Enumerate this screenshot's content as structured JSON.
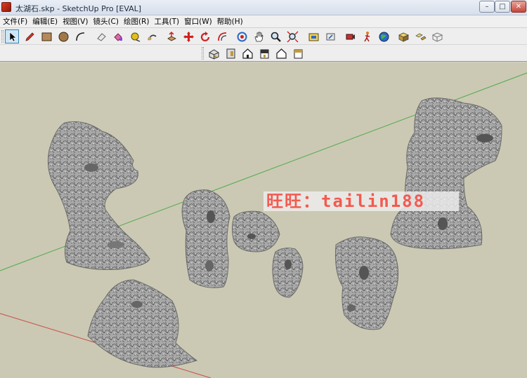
{
  "window": {
    "title": "太湖石.skp - SketchUp Pro [EVAL]",
    "minimize": "–",
    "maximize": "□",
    "close": "✕"
  },
  "menu": {
    "items": [
      "文件(F)",
      "编辑(E)",
      "视图(V)",
      "镜头(C)",
      "绘图(R)",
      "工具(T)",
      "窗口(W)",
      "帮助(H)"
    ]
  },
  "toolbar_main": {
    "tools": [
      "select-tool",
      "pencil-tool",
      "rectangle-tool",
      "circle-tool",
      "arc-tool",
      "eraser-tool",
      "paint-tool",
      "tape-tool",
      "follow-me-tool",
      "push-pull-tool",
      "move-tool",
      "rotate-tool",
      "offset-tool",
      "orbit-tool",
      "pan-tool",
      "zoom-tool",
      "zoom-extents-tool",
      "warehouse-tool",
      "share-model-tool",
      "position-camera-tool",
      "walk-tool",
      "geolocation-tool",
      "component-tool",
      "explode-tool",
      "xray-tool"
    ],
    "active": "select-tool"
  },
  "toolbar_views": {
    "tools": [
      "iso-view",
      "top-view",
      "front-view",
      "right-view",
      "back-view",
      "left-view"
    ]
  },
  "scene": {
    "background": "#cbc9b3",
    "green_axis_color": "#4ba84b",
    "red_axis_color": "#c94a4a",
    "rock_color": "#9d9d9d",
    "watermark": "旺旺：tailin188"
  }
}
